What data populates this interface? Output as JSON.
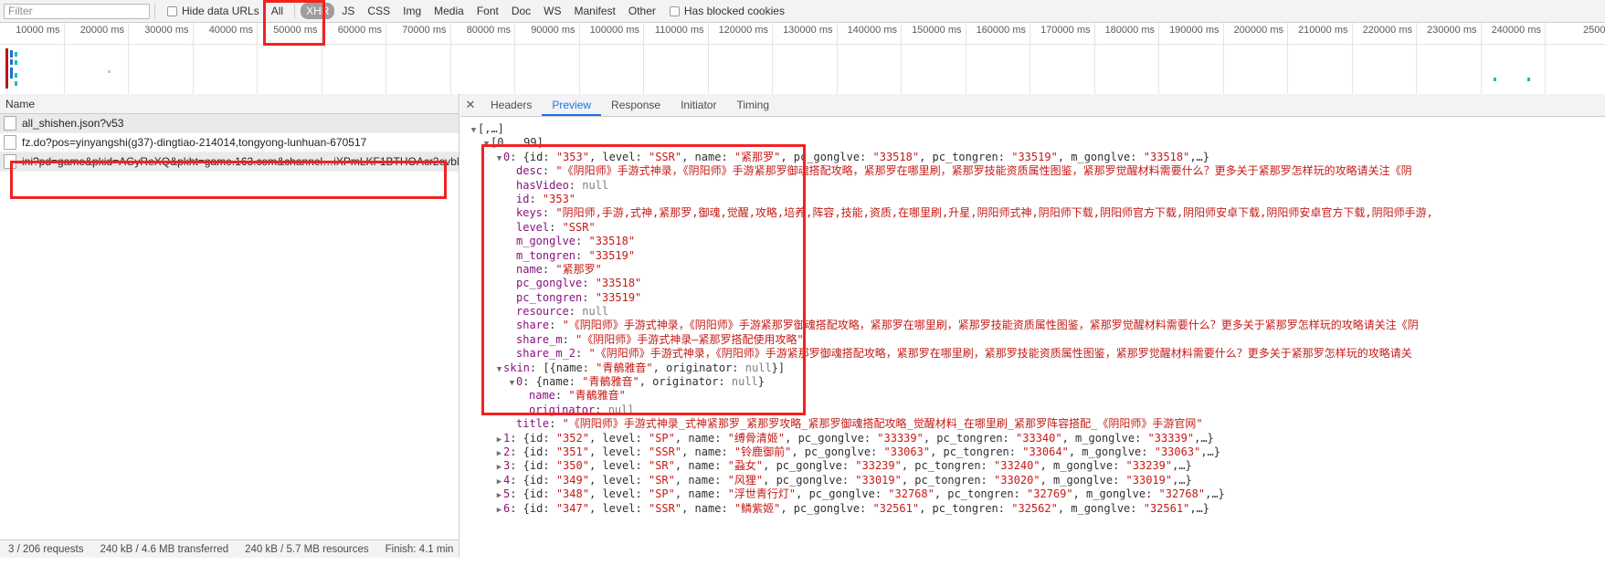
{
  "filter_bar": {
    "filter_placeholder": "Filter",
    "hide_data_urls_label": "Hide data URLs",
    "has_blocked_cookies_label": "Has blocked cookies",
    "types": [
      {
        "label": "All",
        "active": false
      },
      {
        "label": "XHR",
        "active": true
      },
      {
        "label": "JS",
        "active": false
      },
      {
        "label": "CSS",
        "active": false
      },
      {
        "label": "Img",
        "active": false
      },
      {
        "label": "Media",
        "active": false
      },
      {
        "label": "Font",
        "active": false
      },
      {
        "label": "Doc",
        "active": false
      },
      {
        "label": "WS",
        "active": false
      },
      {
        "label": "Manifest",
        "active": false
      },
      {
        "label": "Other",
        "active": false
      }
    ]
  },
  "timeline": {
    "ticks": [
      "10000 ms",
      "20000 ms",
      "30000 ms",
      "40000 ms",
      "50000 ms",
      "60000 ms",
      "70000 ms",
      "80000 ms",
      "90000 ms",
      "100000 ms",
      "110000 ms",
      "120000 ms",
      "130000 ms",
      "140000 ms",
      "150000 ms",
      "160000 ms",
      "170000 ms",
      "180000 ms",
      "190000 ms",
      "200000 ms",
      "210000 ms",
      "220000 ms",
      "230000 ms",
      "240000 ms",
      "2500"
    ]
  },
  "requests": {
    "column_header": "Name",
    "rows": [
      {
        "name": "all_shishen.json?v53"
      },
      {
        "name": "fz.do?pos=yinyangshi(g37)-dingtiao-214014,tongyong-lunhuan-670517"
      },
      {
        "name": "ini?pd=game&pkid=AGyReXQ&pkht=game.163.com&channel…iXPmLKF1BTHOAcr2evbN…"
      }
    ]
  },
  "detail": {
    "close_label": "✕",
    "tabs": [
      {
        "label": "Headers",
        "active": false
      },
      {
        "label": "Preview",
        "active": true
      },
      {
        "label": "Response",
        "active": false
      },
      {
        "label": "Initiator",
        "active": false
      },
      {
        "label": "Timing",
        "active": false
      }
    ]
  },
  "preview": {
    "lines": [
      {
        "indent": 0,
        "tri": "open",
        "parts": [
          {
            "t": "[,…]",
            "c": "punct"
          }
        ]
      },
      {
        "indent": 1,
        "tri": "open",
        "parts": [
          {
            "t": "[0 … 99]",
            "c": "punct"
          }
        ]
      },
      {
        "indent": 2,
        "tri": "open",
        "parts": [
          {
            "t": "0",
            "c": "k-index"
          },
          {
            "t": ": {id: ",
            "c": "punct"
          },
          {
            "t": "\"353\"",
            "c": "v-str"
          },
          {
            "t": ", level: ",
            "c": "punct"
          },
          {
            "t": "\"SSR\"",
            "c": "v-str"
          },
          {
            "t": ", name: ",
            "c": "punct"
          },
          {
            "t": "\"紧那罗\"",
            "c": "v-str"
          },
          {
            "t": ", pc_gonglve: ",
            "c": "punct"
          },
          {
            "t": "\"33518\"",
            "c": "v-str"
          },
          {
            "t": ", pc_tongren: ",
            "c": "punct"
          },
          {
            "t": "\"33519\"",
            "c": "v-str"
          },
          {
            "t": ", m_gonglve: ",
            "c": "punct"
          },
          {
            "t": "\"33518\"",
            "c": "v-str"
          },
          {
            "t": ",…}",
            "c": "punct"
          }
        ]
      },
      {
        "indent": 3,
        "tri": "none",
        "parts": [
          {
            "t": "desc",
            "c": "k-prop"
          },
          {
            "t": ": ",
            "c": "punct"
          },
          {
            "t": "\"《阴阳师》手游式神录，《阴阳师》手游紧那罗御魂搭配攻略，紧那罗在哪里刷，紧那罗技能资质属性图鉴，紧那罗觉醒材料需要什么？更多关于紧那罗怎样玩的攻略请关注《阴",
            "c": "v-str"
          }
        ]
      },
      {
        "indent": 3,
        "tri": "none",
        "parts": [
          {
            "t": "hasVideo",
            "c": "k-prop"
          },
          {
            "t": ": ",
            "c": "punct"
          },
          {
            "t": "null",
            "c": "v-null"
          }
        ]
      },
      {
        "indent": 3,
        "tri": "none",
        "parts": [
          {
            "t": "id",
            "c": "k-prop"
          },
          {
            "t": ": ",
            "c": "punct"
          },
          {
            "t": "\"353\"",
            "c": "v-str"
          }
        ]
      },
      {
        "indent": 3,
        "tri": "none",
        "parts": [
          {
            "t": "keys",
            "c": "k-prop"
          },
          {
            "t": ": ",
            "c": "punct"
          },
          {
            "t": "\"阴阳师,手游,式神,紧那罗,御魂,觉醒,攻略,培养,阵容,技能,资质,在哪里刷,升星,阴阳师式神,阴阳师下载,阴阳师官方下载,阴阳师安卓下载,阴阳师安卓官方下载,阴阳师手游,",
            "c": "v-str"
          }
        ]
      },
      {
        "indent": 3,
        "tri": "none",
        "parts": [
          {
            "t": "level",
            "c": "k-prop"
          },
          {
            "t": ": ",
            "c": "punct"
          },
          {
            "t": "\"SSR\"",
            "c": "v-str"
          }
        ]
      },
      {
        "indent": 3,
        "tri": "none",
        "parts": [
          {
            "t": "m_gonglve",
            "c": "k-prop"
          },
          {
            "t": ": ",
            "c": "punct"
          },
          {
            "t": "\"33518\"",
            "c": "v-str"
          }
        ]
      },
      {
        "indent": 3,
        "tri": "none",
        "parts": [
          {
            "t": "m_tongren",
            "c": "k-prop"
          },
          {
            "t": ": ",
            "c": "punct"
          },
          {
            "t": "\"33519\"",
            "c": "v-str"
          }
        ]
      },
      {
        "indent": 3,
        "tri": "none",
        "parts": [
          {
            "t": "name",
            "c": "k-prop"
          },
          {
            "t": ": ",
            "c": "punct"
          },
          {
            "t": "\"紧那罗\"",
            "c": "v-str"
          }
        ]
      },
      {
        "indent": 3,
        "tri": "none",
        "parts": [
          {
            "t": "pc_gonglve",
            "c": "k-prop"
          },
          {
            "t": ": ",
            "c": "punct"
          },
          {
            "t": "\"33518\"",
            "c": "v-str"
          }
        ]
      },
      {
        "indent": 3,
        "tri": "none",
        "parts": [
          {
            "t": "pc_tongren",
            "c": "k-prop"
          },
          {
            "t": ": ",
            "c": "punct"
          },
          {
            "t": "\"33519\"",
            "c": "v-str"
          }
        ]
      },
      {
        "indent": 3,
        "tri": "none",
        "parts": [
          {
            "t": "resource",
            "c": "k-prop"
          },
          {
            "t": ": ",
            "c": "punct"
          },
          {
            "t": "null",
            "c": "v-null"
          }
        ]
      },
      {
        "indent": 3,
        "tri": "none",
        "parts": [
          {
            "t": "share",
            "c": "k-prop"
          },
          {
            "t": ": ",
            "c": "punct"
          },
          {
            "t": "\"《阴阳师》手游式神录，《阴阳师》手游紧那罗御魂搭配攻略，紧那罗在哪里刷，紧那罗技能资质属性图鉴，紧那罗觉醒材料需要什么？更多关于紧那罗怎样玩的攻略请关注《阴",
            "c": "v-str"
          }
        ]
      },
      {
        "indent": 3,
        "tri": "none",
        "parts": [
          {
            "t": "share_m",
            "c": "k-prop"
          },
          {
            "t": ": ",
            "c": "punct"
          },
          {
            "t": "\"《阴阳师》手游式神录—紧那罗搭配使用攻略\"",
            "c": "v-str"
          }
        ]
      },
      {
        "indent": 3,
        "tri": "none",
        "parts": [
          {
            "t": "share_m_2",
            "c": "k-prop"
          },
          {
            "t": ": ",
            "c": "punct"
          },
          {
            "t": "\"《阴阳师》手游式神录，《阴阳师》手游紧那罗御魂搭配攻略，紧那罗在哪里刷，紧那罗技能资质属性图鉴，紧那罗觉醒材料需要什么？更多关于紧那罗怎样玩的攻略请关",
            "c": "v-str"
          }
        ]
      },
      {
        "indent": 2,
        "tri": "open",
        "parts": [
          {
            "t": "skin",
            "c": "k-prop"
          },
          {
            "t": ": [{name: ",
            "c": "punct"
          },
          {
            "t": "\"青鶺雅音\"",
            "c": "v-str"
          },
          {
            "t": ", originator: ",
            "c": "punct"
          },
          {
            "t": "null",
            "c": "v-null"
          },
          {
            "t": "}]",
            "c": "punct"
          }
        ]
      },
      {
        "indent": 3,
        "tri": "open",
        "parts": [
          {
            "t": "0",
            "c": "k-index"
          },
          {
            "t": ": {name: ",
            "c": "punct"
          },
          {
            "t": "\"青鶺雅音\"",
            "c": "v-str"
          },
          {
            "t": ", originator: ",
            "c": "punct"
          },
          {
            "t": "null",
            "c": "v-null"
          },
          {
            "t": "}",
            "c": "punct"
          }
        ]
      },
      {
        "indent": 4,
        "tri": "none",
        "parts": [
          {
            "t": "name",
            "c": "k-prop"
          },
          {
            "t": ": ",
            "c": "punct"
          },
          {
            "t": "\"青鶺雅音\"",
            "c": "v-str"
          }
        ]
      },
      {
        "indent": 4,
        "tri": "none",
        "parts": [
          {
            "t": "originator",
            "c": "k-prop"
          },
          {
            "t": ": ",
            "c": "punct"
          },
          {
            "t": "null",
            "c": "v-null"
          }
        ]
      },
      {
        "indent": 3,
        "tri": "none",
        "parts": [
          {
            "t": "title",
            "c": "k-prop"
          },
          {
            "t": ": ",
            "c": "punct"
          },
          {
            "t": "\"《阴阳师》手游式神录_式神紧那罗_紧那罗攻略_紧那罗御魂搭配攻略_觉醒材料_在哪里刷_紧那罗阵容搭配_《阴阳师》手游官网\"",
            "c": "v-str"
          }
        ]
      },
      {
        "indent": 2,
        "tri": "closed",
        "parts": [
          {
            "t": "1",
            "c": "k-index"
          },
          {
            "t": ": {id: ",
            "c": "punct"
          },
          {
            "t": "\"352\"",
            "c": "v-str"
          },
          {
            "t": ", level: ",
            "c": "punct"
          },
          {
            "t": "\"SP\"",
            "c": "v-str"
          },
          {
            "t": ", name: ",
            "c": "punct"
          },
          {
            "t": "\"缚骨清姬\"",
            "c": "v-str"
          },
          {
            "t": ", pc_gonglve: ",
            "c": "punct"
          },
          {
            "t": "\"33339\"",
            "c": "v-str"
          },
          {
            "t": ", pc_tongren: ",
            "c": "punct"
          },
          {
            "t": "\"33340\"",
            "c": "v-str"
          },
          {
            "t": ", m_gonglve: ",
            "c": "punct"
          },
          {
            "t": "\"33339\"",
            "c": "v-str"
          },
          {
            "t": ",…}",
            "c": "punct"
          }
        ]
      },
      {
        "indent": 2,
        "tri": "closed",
        "parts": [
          {
            "t": "2",
            "c": "k-index"
          },
          {
            "t": ": {id: ",
            "c": "punct"
          },
          {
            "t": "\"351\"",
            "c": "v-str"
          },
          {
            "t": ", level: ",
            "c": "punct"
          },
          {
            "t": "\"SSR\"",
            "c": "v-str"
          },
          {
            "t": ", name: ",
            "c": "punct"
          },
          {
            "t": "\"铃鹿御前\"",
            "c": "v-str"
          },
          {
            "t": ", pc_gonglve: ",
            "c": "punct"
          },
          {
            "t": "\"33063\"",
            "c": "v-str"
          },
          {
            "t": ", pc_tongren: ",
            "c": "punct"
          },
          {
            "t": "\"33064\"",
            "c": "v-str"
          },
          {
            "t": ", m_gonglve: ",
            "c": "punct"
          },
          {
            "t": "\"33063\"",
            "c": "v-str"
          },
          {
            "t": ",…}",
            "c": "punct"
          }
        ]
      },
      {
        "indent": 2,
        "tri": "closed",
        "parts": [
          {
            "t": "3",
            "c": "k-index"
          },
          {
            "t": ": {id: ",
            "c": "punct"
          },
          {
            "t": "\"350\"",
            "c": "v-str"
          },
          {
            "t": ", level: ",
            "c": "punct"
          },
          {
            "t": "\"SR\"",
            "c": "v-str"
          },
          {
            "t": ", name: ",
            "c": "punct"
          },
          {
            "t": "\"蝨女\"",
            "c": "v-str"
          },
          {
            "t": ", pc_gonglve: ",
            "c": "punct"
          },
          {
            "t": "\"33239\"",
            "c": "v-str"
          },
          {
            "t": ", pc_tongren: ",
            "c": "punct"
          },
          {
            "t": "\"33240\"",
            "c": "v-str"
          },
          {
            "t": ", m_gonglve: ",
            "c": "punct"
          },
          {
            "t": "\"33239\"",
            "c": "v-str"
          },
          {
            "t": ",…}",
            "c": "punct"
          }
        ]
      },
      {
        "indent": 2,
        "tri": "closed",
        "parts": [
          {
            "t": "4",
            "c": "k-index"
          },
          {
            "t": ": {id: ",
            "c": "punct"
          },
          {
            "t": "\"349\"",
            "c": "v-str"
          },
          {
            "t": ", level: ",
            "c": "punct"
          },
          {
            "t": "\"SR\"",
            "c": "v-str"
          },
          {
            "t": ", name: ",
            "c": "punct"
          },
          {
            "t": "\"风狸\"",
            "c": "v-str"
          },
          {
            "t": ", pc_gonglve: ",
            "c": "punct"
          },
          {
            "t": "\"33019\"",
            "c": "v-str"
          },
          {
            "t": ", pc_tongren: ",
            "c": "punct"
          },
          {
            "t": "\"33020\"",
            "c": "v-str"
          },
          {
            "t": ", m_gonglve: ",
            "c": "punct"
          },
          {
            "t": "\"33019\"",
            "c": "v-str"
          },
          {
            "t": ",…}",
            "c": "punct"
          }
        ]
      },
      {
        "indent": 2,
        "tri": "closed",
        "parts": [
          {
            "t": "5",
            "c": "k-index"
          },
          {
            "t": ": {id: ",
            "c": "punct"
          },
          {
            "t": "\"348\"",
            "c": "v-str"
          },
          {
            "t": ", level: ",
            "c": "punct"
          },
          {
            "t": "\"SP\"",
            "c": "v-str"
          },
          {
            "t": ", name: ",
            "c": "punct"
          },
          {
            "t": "\"浮世青行灯\"",
            "c": "v-str"
          },
          {
            "t": ", pc_gonglve: ",
            "c": "punct"
          },
          {
            "t": "\"32768\"",
            "c": "v-str"
          },
          {
            "t": ", pc_tongren: ",
            "c": "punct"
          },
          {
            "t": "\"32769\"",
            "c": "v-str"
          },
          {
            "t": ", m_gonglve: ",
            "c": "punct"
          },
          {
            "t": "\"32768\"",
            "c": "v-str"
          },
          {
            "t": ",…}",
            "c": "punct"
          }
        ]
      },
      {
        "indent": 2,
        "tri": "closed",
        "parts": [
          {
            "t": "6",
            "c": "k-index"
          },
          {
            "t": ": {id: ",
            "c": "punct"
          },
          {
            "t": "\"347\"",
            "c": "v-str"
          },
          {
            "t": ", level: ",
            "c": "punct"
          },
          {
            "t": "\"SSR\"",
            "c": "v-str"
          },
          {
            "t": ", name: ",
            "c": "punct"
          },
          {
            "t": "\"鳞紫姬\"",
            "c": "v-str"
          },
          {
            "t": ", pc_gonglve: ",
            "c": "punct"
          },
          {
            "t": "\"32561\"",
            "c": "v-str"
          },
          {
            "t": ", pc_tongren: ",
            "c": "punct"
          },
          {
            "t": "\"32562\"",
            "c": "v-str"
          },
          {
            "t": ", m_gonglve: ",
            "c": "punct"
          },
          {
            "t": "\"32561\"",
            "c": "v-str"
          },
          {
            "t": ",…}",
            "c": "punct"
          }
        ]
      }
    ]
  },
  "status_bar": {
    "requests": "3 / 206 requests",
    "transferred": "240 kB / 4.6 MB transferred",
    "resources": "240 kB / 5.7 MB resources",
    "finish": "Finish: 4.1 min"
  },
  "colors": {
    "accent": "#1a73e8",
    "annotation": "#f42121",
    "active_filter_bg": "#9e9e9e",
    "string_value": "#c41a16",
    "property_key": "#881280"
  }
}
